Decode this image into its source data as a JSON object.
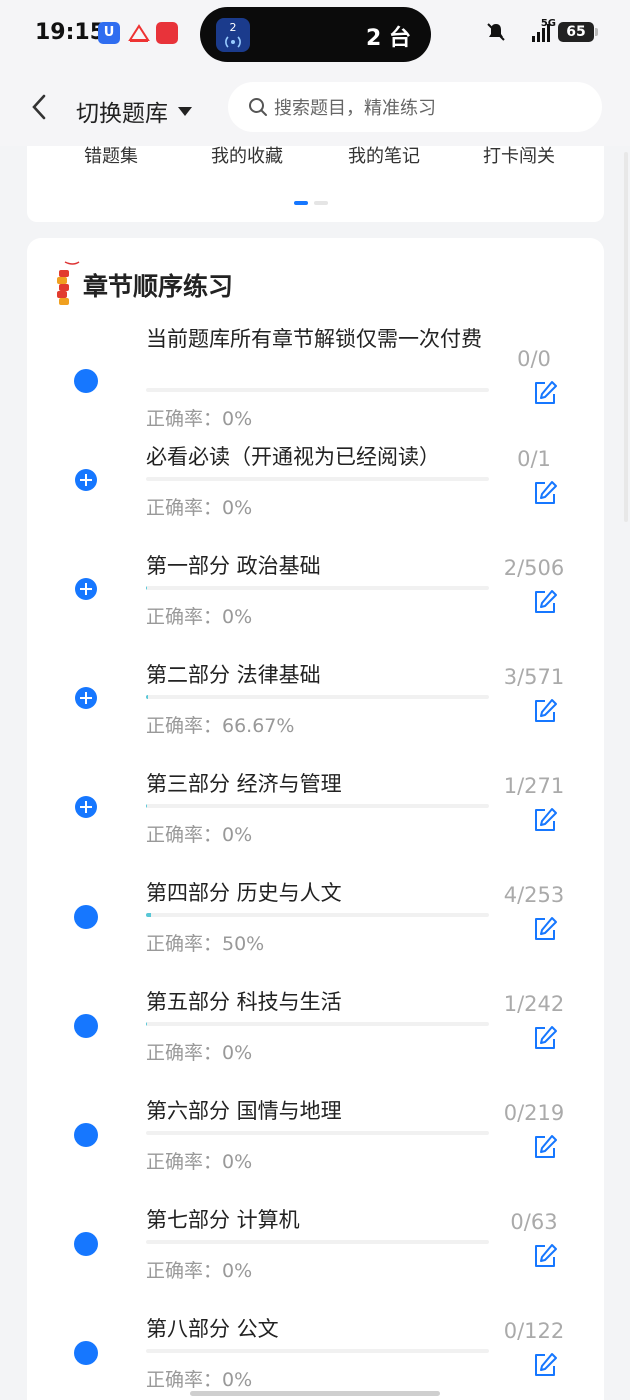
{
  "status_bar": {
    "time": "19:15",
    "app1_letter": "U",
    "island_badge": "2",
    "island_text": "2 台",
    "network": "5G",
    "battery": "65"
  },
  "header": {
    "title": "切换题库",
    "search_placeholder": "搜索题目，精准练习"
  },
  "shortcuts": [
    "错题集",
    "我的收藏",
    "我的笔记",
    "打卡闯关"
  ],
  "section": {
    "title": "章节顺序练习",
    "accuracy_prefix": "正确率："
  },
  "chapters": [
    {
      "title": "当前题库所有章节解锁仅需一次付费",
      "accuracy": "正确率：0%",
      "progress_fraction": 0,
      "count": "0/0",
      "marker": "dot"
    },
    {
      "title": "必看必读（开通视为已经阅读）",
      "accuracy": "正确率：0%",
      "progress_fraction": 0,
      "count": "0/1",
      "marker": "plus"
    },
    {
      "title": "第一部分 政治基础",
      "accuracy": "正确率：0%",
      "progress_fraction": 0.004,
      "count": "2/506",
      "marker": "plus"
    },
    {
      "title": "第二部分 法律基础",
      "accuracy": "正确率：66.67%",
      "progress_fraction": 0.005,
      "count": "3/571",
      "marker": "plus"
    },
    {
      "title": "第三部分 经济与管理",
      "accuracy": "正确率：0%",
      "progress_fraction": 0.004,
      "count": "1/271",
      "marker": "plus"
    },
    {
      "title": "第四部分 历史与人文",
      "accuracy": "正确率：50%",
      "progress_fraction": 0.016,
      "count": "4/253",
      "marker": "dot"
    },
    {
      "title": "第五部分 科技与生活",
      "accuracy": "正确率：0%",
      "progress_fraction": 0.004,
      "count": "1/242",
      "marker": "dot"
    },
    {
      "title": "第六部分 国情与地理",
      "accuracy": "正确率：0%",
      "progress_fraction": 0,
      "count": "0/219",
      "marker": "dot"
    },
    {
      "title": "第七部分 计算机",
      "accuracy": "正确率：0%",
      "progress_fraction": 0,
      "count": "0/63",
      "marker": "dot"
    },
    {
      "title": "第八部分 公文",
      "accuracy": "正确率：0%",
      "progress_fraction": 0,
      "count": "0/122",
      "marker": "dot"
    }
  ],
  "colors": {
    "accent": "#1677ff",
    "progress": "#58c7d6",
    "muted_text": "#999999"
  }
}
